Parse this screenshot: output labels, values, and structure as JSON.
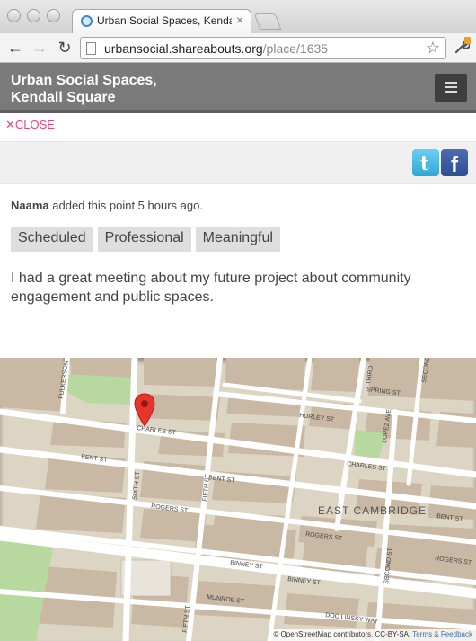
{
  "browser": {
    "tab_title": "Urban Social Spaces, Kendall",
    "tab_close": "×",
    "url_host": "urbansocial.shareabouts.org",
    "url_path": "/place/1635",
    "back_icon": "←",
    "forward_icon": "→",
    "reload_icon": "↻",
    "star_icon": "☆",
    "wrench_icon": "🔧"
  },
  "header": {
    "title_line1": "Urban Social Spaces,",
    "title_line2": "Kendall Square"
  },
  "place": {
    "close_label": "CLOSE",
    "close_icon": "✕",
    "author": "Naama",
    "added_text": "added this point 5 hours ago.",
    "tags": [
      "Scheduled",
      "Professional",
      "Meaningful"
    ],
    "description": "I had a great meeting about my future project about community engagement and public spaces.",
    "share": {
      "twitter_glyph": "t",
      "facebook_glyph": "f"
    }
  },
  "map": {
    "street_labels": {
      "fulkerson": "FULKERSON",
      "third": "THIRD",
      "second_top": "SECOND ST",
      "spring": "SPRING ST",
      "hurley": "HURLEY ST",
      "charles_w": "CHARLES ST",
      "charles_e": "CHARLES ST",
      "lopez": "LOPEZ AVE",
      "bent_w": "BENT ST",
      "bent_mid": "BENT ST",
      "bent_e": "BENT ST",
      "sixth": "SIXTH ST",
      "fifth": "FIFTH ST",
      "rogers_w": "ROGERS ST",
      "rogers_mid": "ROGERS ST",
      "rogers_e": "ROGERS ST",
      "binney_w": "BINNEY ST",
      "binney_e": "BINNEY ST",
      "second_low": "SECOND ST",
      "munroe": "MUNROE ST",
      "doc_linsky": "DOC LINSKY WAY",
      "fifth_low": "FIFTH ST"
    },
    "area_label": "EAST CAMBRIDGE",
    "attribution_text": "© OpenStreetMap contributors, CC-BY-SA.",
    "attribution_link": "Terms & Feedback"
  },
  "colors": {
    "accent_pink": "#e8467c",
    "header_bg": "#7a7a7a",
    "menu_bg": "#3e3e3e",
    "tag_bg": "#dedede",
    "map_road": "#ffffff",
    "map_block": "#c9b8a3",
    "map_park": "#b7d89e"
  }
}
